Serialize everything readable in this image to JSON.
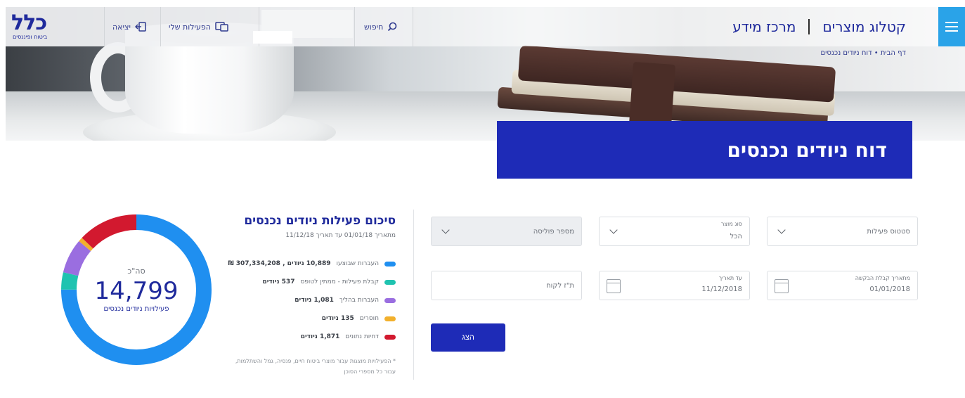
{
  "header": {
    "logo_text": "כלל",
    "logo_subtext": "ביטוח ופיננסים",
    "exit_label": "יציאה",
    "my_activities_label": "הפעילות שלי",
    "search_label": "חיפוש",
    "nav": [
      {
        "label": "קטלוג מוצרים"
      },
      {
        "label": "מרכז מידע"
      }
    ],
    "breadcrumb": "דף הבית • דוח ניודים נכנסים"
  },
  "page_title": "דוח ניודים נכנסים",
  "form": {
    "activity_status": {
      "placeholder": "סטטוס פעילות"
    },
    "product_type": {
      "label": "סוג מוצר",
      "value": "הכל"
    },
    "policy_number": {
      "placeholder": "מספר פוליסה"
    },
    "start_date": {
      "label": "מתאריך קבלת הבקשה",
      "value": "01/01/2018"
    },
    "end_date": {
      "label": "עד תאריך",
      "value": "11/12/2018"
    },
    "id_number": {
      "placeholder": "ת\"ז לקוח"
    },
    "show_button": "הצג"
  },
  "summary": {
    "title": "סיכום פעילות ניודים נכנסים",
    "subtitle": "מתאריך 01/01/18 עד תאריך 11/12/18",
    "legend": [
      {
        "label": "העברות שבוצעו",
        "value": "10,889 ניודים , 307,334,208 ₪",
        "color": "#1f8ff0"
      },
      {
        "label": "קבלת פעילות - ממתין לטופס",
        "value": "537 ניודים",
        "color": "#1fc3b0"
      },
      {
        "label": "העברות בהליך",
        "value": "1,081 ניודים",
        "color": "#9a6ee0"
      },
      {
        "label": "חוסרים",
        "value": "135 ניודים",
        "color": "#f2b02c"
      },
      {
        "label": "דחיות נתונים",
        "value": "1,871 ניודים",
        "color": "#d2192f"
      }
    ],
    "footnote": "* הפעילויות מוצגות עבור מוצרי ביטוח חיים, פנסיה, גמל והשתלמות, עבור כל מספרי הסוכן",
    "total_label": "סה\"כ",
    "total_value": "14,799",
    "total_caption": "פעילויות ניודים נכנסים"
  },
  "chart_data": {
    "type": "pie",
    "donut": true,
    "categories": [
      "העברות שבוצעו",
      "קבלת פעילות - ממתין לטופס",
      "העברות בהליך",
      "חוסרים",
      "דחיות נתונים"
    ],
    "values": [
      10889,
      537,
      1081,
      135,
      1871
    ],
    "colors": [
      "#1f8ff0",
      "#1fc3b0",
      "#9a6ee0",
      "#f2b02c",
      "#d2192f"
    ]
  }
}
